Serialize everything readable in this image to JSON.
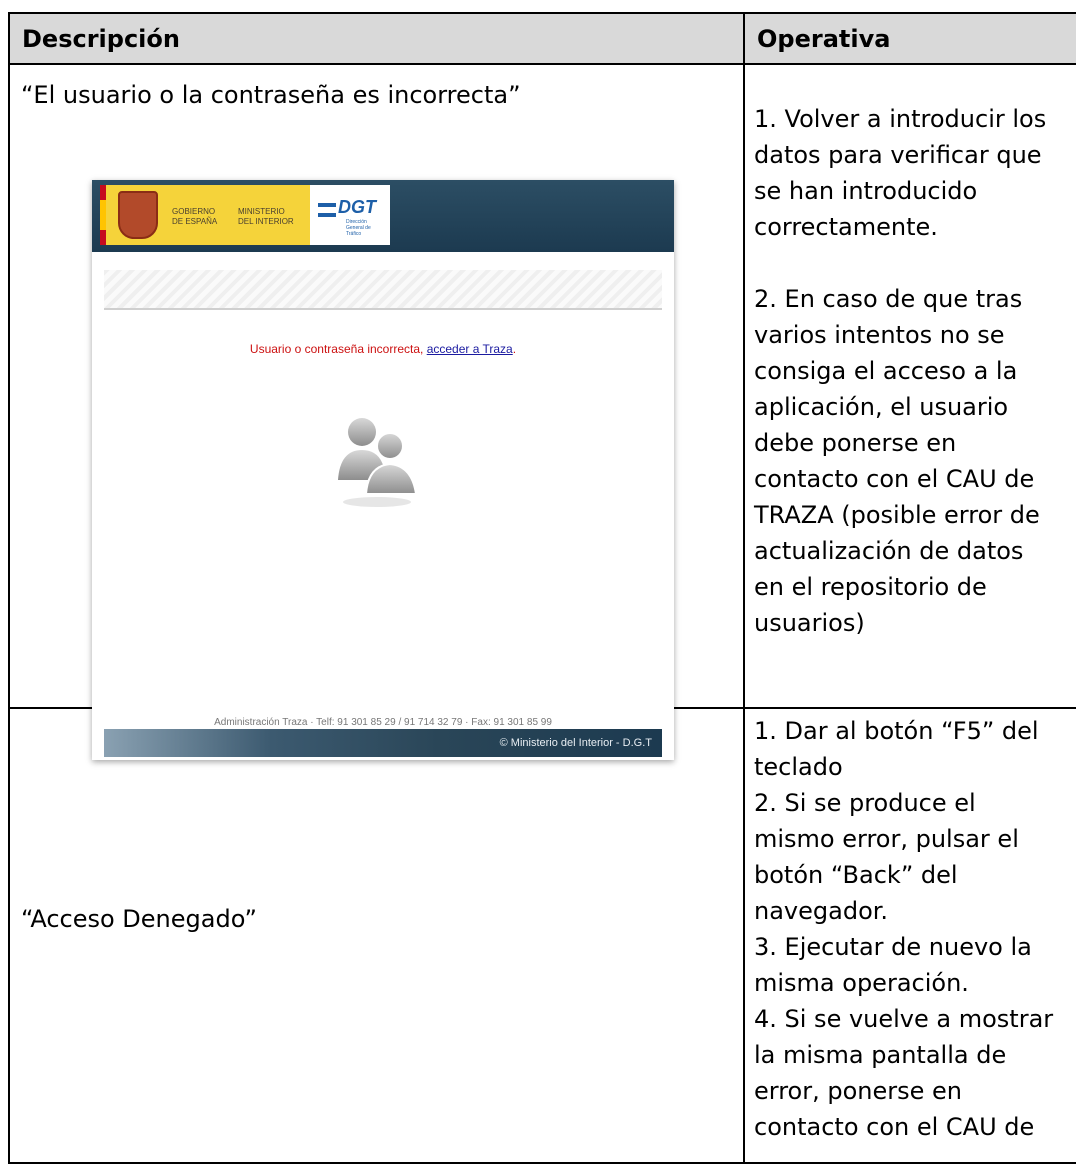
{
  "table": {
    "header": {
      "col1": "Descripción",
      "col2": "Operativa"
    },
    "rows": [
      {
        "descripcion": "“El usuario o la contraseña es incorrecta”",
        "operativa_lines": [
          "1.  Volver a introducir los",
          "datos para verificar que",
          "se han introducido",
          "correctamente.",
          "",
          "2.  En caso de que tras",
          "varios intentos  no se",
          "consiga el acceso a la",
          "aplicación, el usuario",
          "debe ponerse  en",
          "contacto con el CAU de",
          "TRAZA (posible error de",
          "actualización de datos",
          "en el repositorio de",
          "usuarios)"
        ]
      },
      {
        "descripcion": "“Acceso Denegado”",
        "operativa_lines": [
          "1.  Dar al botón  “F5” del",
          "teclado",
          "2.  Si se produce  el",
          "mismo error, pulsar el",
          "botón  “Back” del",
          "navegador.",
          "3.  Ejecutar de nuevo la",
          "misma operación.",
          "4.  Si se vuelve a mostrar",
          "la misma pantalla de",
          "error, ponerse en",
          "contacto con el CAU de"
        ]
      }
    ]
  },
  "screenshot": {
    "logo_gobierno": "GOBIERNO\nDE ESPAÑA",
    "logo_ministerio": "MINISTERIO\nDEL INTERIOR",
    "logo_dgt": "DGT",
    "logo_dgt_sub": "Dirección General de Tráfico",
    "message": "Usuario o contraseña incorrecta,",
    "link": "acceder a Traza",
    "message_end": ".",
    "footer_contact": "Administración Traza · Telf: 91 301 85 29 / 91 714 32 79 · Fax: 91 301 85 99",
    "footer_copy": "© Ministerio del Interior - D.G.T"
  },
  "colors": {
    "header_bg": "#d9d9d9",
    "banner": "#1c3a50",
    "error_text": "#cc1111",
    "link": "#1a1aa0"
  }
}
